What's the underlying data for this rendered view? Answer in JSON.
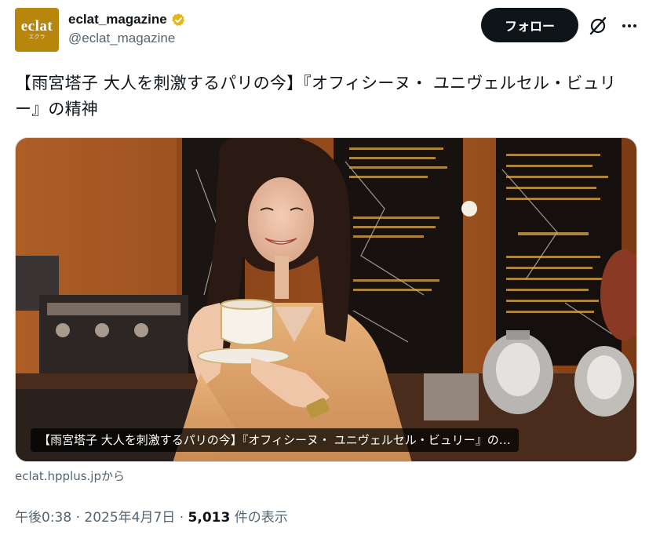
{
  "account": {
    "avatar_logo": "eclat",
    "avatar_sub": "エクラ",
    "display_name": "eclat_magazine",
    "handle": "@eclat_magazine",
    "verified_color": "#e2b719"
  },
  "actions": {
    "follow_label": "フォロー",
    "grok_icon": "grok-slash-icon",
    "more_icon": "more-dots-icon"
  },
  "tweet": {
    "text": "【雨宮塔子 大人を刺激するパリの今】『オフィシーヌ・ ユニヴェルセル・ビュリー』の精神"
  },
  "card": {
    "caption": "【雨宮塔子 大人を刺激するパリの今】『オフィシーヌ・ ユニヴェルセル・ビュリー』の…",
    "source": "eclat.hpplus.jpから"
  },
  "meta": {
    "time": "午後0:38",
    "date": "2025年4月7日",
    "separator": "·",
    "views_count": "5,013",
    "views_label": "件の表示"
  }
}
